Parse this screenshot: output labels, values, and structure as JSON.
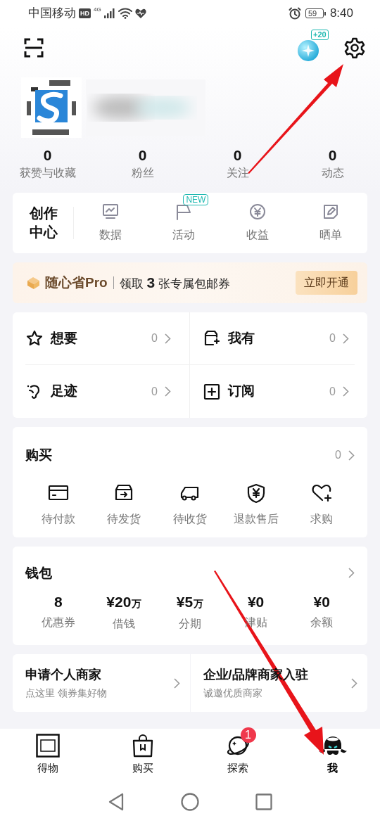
{
  "status_bar": {
    "carrier": "中国移动",
    "hd_badge": "HD",
    "network": "4G",
    "battery": "59",
    "time": "8:40"
  },
  "header": {
    "coin_badge": "+20"
  },
  "stats": [
    {
      "value": "0",
      "label": "获赞与收藏"
    },
    {
      "value": "0",
      "label": "粉丝"
    },
    {
      "value": "0",
      "label": "关注"
    },
    {
      "value": "0",
      "label": "动态"
    }
  ],
  "creator": {
    "title": "创作中心",
    "items": [
      {
        "label": "数据",
        "kind": "chart"
      },
      {
        "label": "活动",
        "kind": "flag",
        "badge": "NEW"
      },
      {
        "label": "收益",
        "kind": "yen"
      },
      {
        "label": "晒单",
        "kind": "edit"
      }
    ]
  },
  "promo": {
    "brand": "随心省Pro",
    "text": "领取 **3** 张专属包邮券",
    "button": "立即开通"
  },
  "collections": [
    {
      "label": "想要",
      "count": "0",
      "kind": "star"
    },
    {
      "label": "我有",
      "count": "0",
      "kind": "box-plus"
    },
    {
      "label": "足迹",
      "count": "0",
      "kind": "foot"
    },
    {
      "label": "订阅",
      "count": "0",
      "kind": "plus-square"
    }
  ],
  "orders": {
    "title": "购买",
    "count": "0",
    "items": [
      {
        "label": "待付款",
        "kind": "card"
      },
      {
        "label": "待发货",
        "kind": "box"
      },
      {
        "label": "待收货",
        "kind": "truck"
      },
      {
        "label": "退款售后",
        "kind": "shield"
      },
      {
        "label": "求购",
        "kind": "heart-plus"
      }
    ]
  },
  "wallet": {
    "title": "钱包",
    "items": [
      {
        "value": "8",
        "label": "优惠券"
      },
      {
        "value": "¥20",
        "unit": "万",
        "label": "借钱"
      },
      {
        "value": "¥5",
        "unit": "万",
        "label": "分期"
      },
      {
        "value": "¥0",
        "label": "津贴"
      },
      {
        "value": "¥0",
        "label": "余额"
      }
    ]
  },
  "merchant": [
    {
      "title": "申请个人商家",
      "subtitle": "点这里 领券集好物"
    },
    {
      "title": "企业/品牌商家入驻",
      "subtitle": "诚邀优质商家"
    }
  ],
  "tabs": [
    {
      "label": "得物",
      "kind": "logo",
      "selected": false
    },
    {
      "label": "购买",
      "kind": "bag",
      "selected": false
    },
    {
      "label": "探索",
      "kind": "planet",
      "badge": "1",
      "selected": false
    },
    {
      "label": "我",
      "kind": "avatar",
      "selected": true
    }
  ]
}
